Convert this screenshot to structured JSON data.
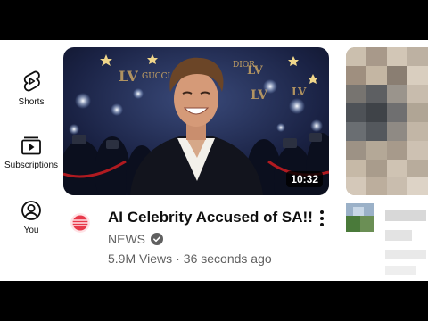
{
  "nav": {
    "items": [
      {
        "label": "Shorts",
        "icon": "shorts-icon"
      },
      {
        "label": "Subscriptions",
        "icon": "subscriptions-icon"
      },
      {
        "label": "You",
        "icon": "account-circle-icon"
      }
    ]
  },
  "video": {
    "duration": "10:32",
    "title": "AI Celebrity Accused of SA!!",
    "channel": "NEWS",
    "views": "5.9M Views",
    "separator": "·",
    "age": "36 seconds ago",
    "verified_icon": "verified-check-icon",
    "more_icon": "more-vert-icon",
    "thumbnail_signage": [
      "GUCCI",
      "DIOR"
    ]
  },
  "colors": {
    "text_primary": "#0f0f0f",
    "text_secondary": "#606060",
    "background": "#ffffff",
    "duration_badge": "#000000"
  }
}
